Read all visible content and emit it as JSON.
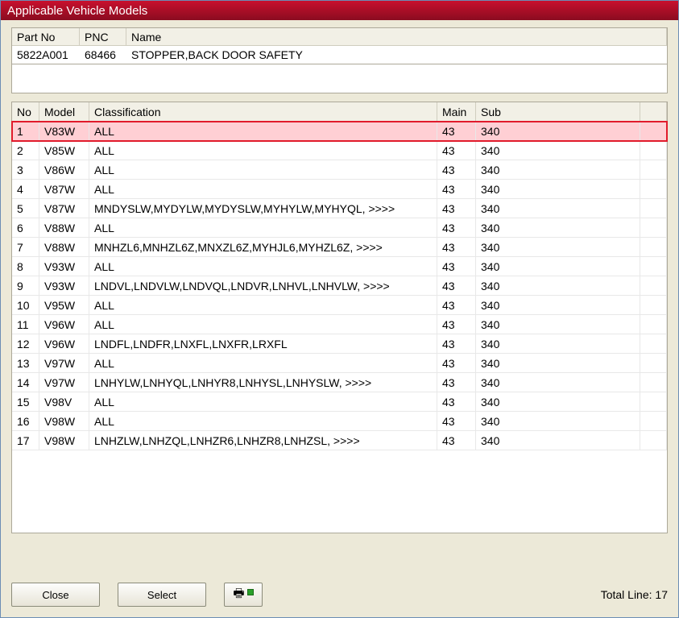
{
  "window": {
    "title": "Applicable Vehicle Models"
  },
  "part_headers": {
    "partno": "Part No",
    "pnc": "PNC",
    "name": "Name"
  },
  "part": {
    "partno": "5822A001",
    "pnc": "68466",
    "name": "STOPPER,BACK DOOR SAFETY"
  },
  "table_headers": {
    "no": "No",
    "model": "Model",
    "classification": "Classification",
    "main": "Main",
    "sub": "Sub"
  },
  "rows": [
    {
      "no": "1",
      "model": "V83W",
      "class": "ALL",
      "main": "43",
      "sub": "340",
      "selected": true
    },
    {
      "no": "2",
      "model": "V85W",
      "class": "ALL",
      "main": "43",
      "sub": "340"
    },
    {
      "no": "3",
      "model": "V86W",
      "class": "ALL",
      "main": "43",
      "sub": "340"
    },
    {
      "no": "4",
      "model": "V87W",
      "class": "ALL",
      "main": "43",
      "sub": "340"
    },
    {
      "no": "5",
      "model": "V87W",
      "class": "MNDYSLW,MYDYLW,MYDYSLW,MYHYLW,MYHYQL,  >>>>",
      "main": "43",
      "sub": "340"
    },
    {
      "no": "6",
      "model": "V88W",
      "class": "ALL",
      "main": "43",
      "sub": "340"
    },
    {
      "no": "7",
      "model": "V88W",
      "class": "MNHZL6,MNHZL6Z,MNXZL6Z,MYHJL6,MYHZL6Z,  >>>>",
      "main": "43",
      "sub": "340"
    },
    {
      "no": "8",
      "model": "V93W",
      "class": "ALL",
      "main": "43",
      "sub": "340"
    },
    {
      "no": "9",
      "model": "V93W",
      "class": "LNDVL,LNDVLW,LNDVQL,LNDVR,LNHVL,LNHVLW,  >>>>",
      "main": "43",
      "sub": "340"
    },
    {
      "no": "10",
      "model": "V95W",
      "class": "ALL",
      "main": "43",
      "sub": "340"
    },
    {
      "no": "11",
      "model": "V96W",
      "class": "ALL",
      "main": "43",
      "sub": "340"
    },
    {
      "no": "12",
      "model": "V96W",
      "class": "LNDFL,LNDFR,LNXFL,LNXFR,LRXFL",
      "main": "43",
      "sub": "340"
    },
    {
      "no": "13",
      "model": "V97W",
      "class": "ALL",
      "main": "43",
      "sub": "340"
    },
    {
      "no": "14",
      "model": "V97W",
      "class": "LNHYLW,LNHYQL,LNHYR8,LNHYSL,LNHYSLW,  >>>>",
      "main": "43",
      "sub": "340"
    },
    {
      "no": "15",
      "model": "V98V",
      "class": "ALL",
      "main": "43",
      "sub": "340"
    },
    {
      "no": "16",
      "model": "V98W",
      "class": "ALL",
      "main": "43",
      "sub": "340"
    },
    {
      "no": "17",
      "model": "V98W",
      "class": "LNHZLW,LNHZQL,LNHZR6,LNHZR8,LNHZSL,  >>>>",
      "main": "43",
      "sub": "340"
    }
  ],
  "buttons": {
    "close": "Close",
    "select": "Select"
  },
  "footer": {
    "total_label": "Total Line:",
    "total_value": "17"
  }
}
